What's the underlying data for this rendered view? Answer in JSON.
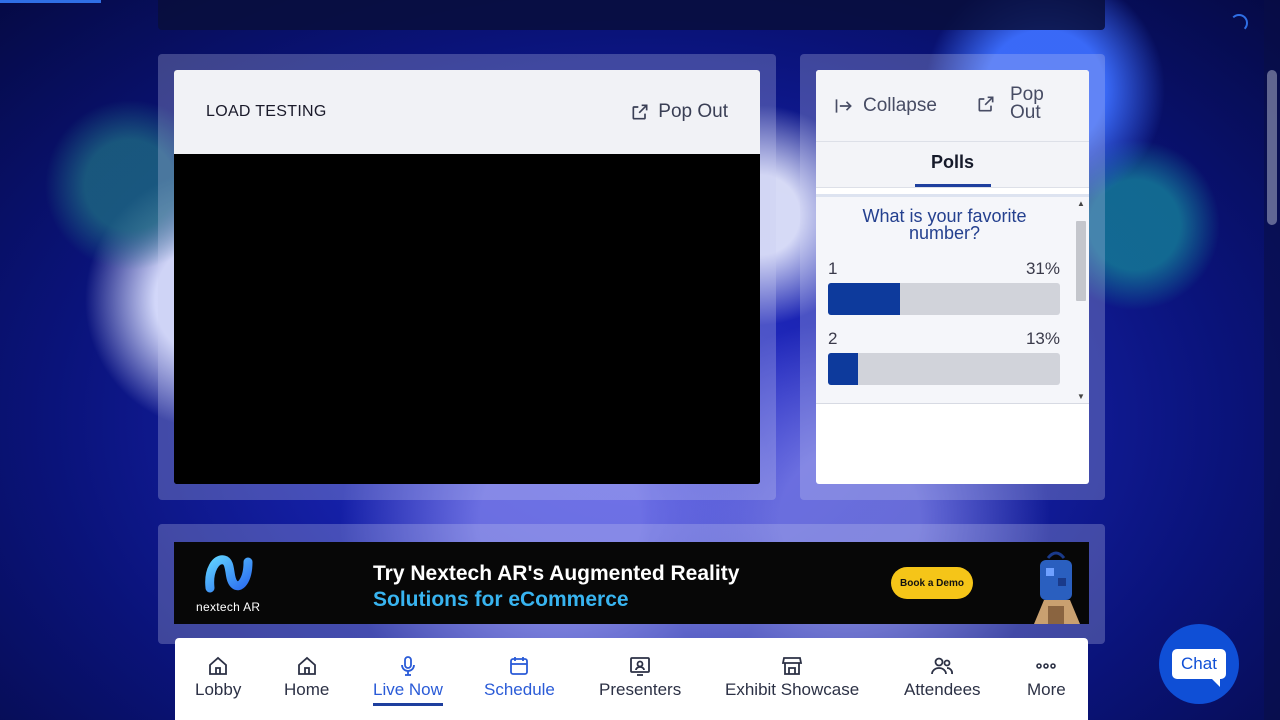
{
  "session": {
    "title": "LOAD TESTING",
    "popout_label": "Pop Out"
  },
  "sidebar": {
    "collapse_label": "Collapse",
    "popout_line1": "Pop",
    "popout_line2": "Out",
    "tab_label": "Polls"
  },
  "poll": {
    "question": "What is your favorite number?",
    "options": [
      {
        "label": "1",
        "percent_text": "31%",
        "percent": 31
      },
      {
        "label": "2",
        "percent_text": "13%",
        "percent": 13
      }
    ]
  },
  "banner": {
    "logo_text": "nextech AR",
    "headline": "Try Nextech AR's Augmented Reality",
    "subheadline": "Solutions for eCommerce",
    "cta": "Book a Demo"
  },
  "nav": {
    "items": [
      {
        "label": "Lobby",
        "icon": "home-icon"
      },
      {
        "label": "Home",
        "icon": "home-icon"
      },
      {
        "label": "Live Now",
        "icon": "microphone-icon"
      },
      {
        "label": "Schedule",
        "icon": "calendar-icon"
      },
      {
        "label": "Presenters",
        "icon": "presenter-icon"
      },
      {
        "label": "Exhibit Showcase",
        "icon": "storefront-icon"
      },
      {
        "label": "Attendees",
        "icon": "people-icon"
      },
      {
        "label": "More",
        "icon": "more-dots-icon"
      }
    ],
    "active": "Live Now"
  },
  "chat": {
    "label": "Chat"
  },
  "colors": {
    "accent": "#2a5bd7",
    "poll_fill": "#0d3a9c",
    "banner_cta": "#f5c518",
    "chat_button": "#0f4fd6"
  }
}
